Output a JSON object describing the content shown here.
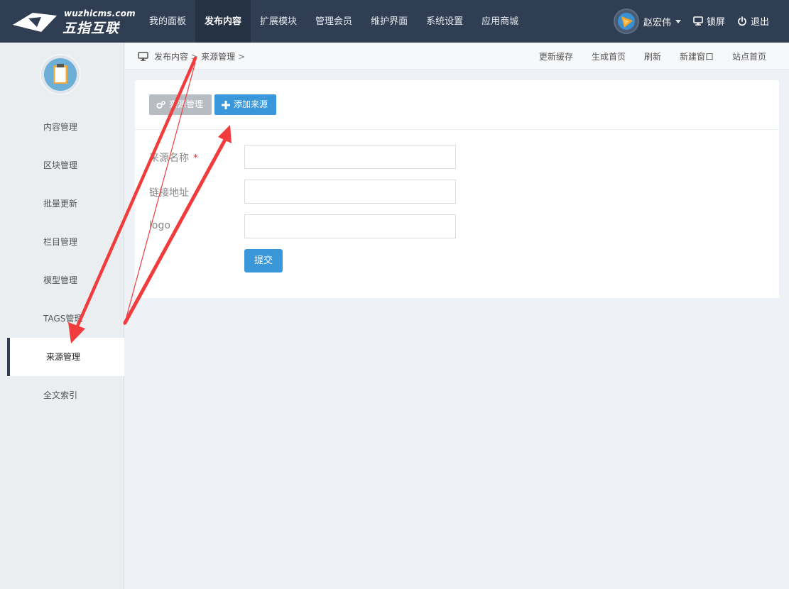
{
  "logo": {
    "en": "wuzhicms.com",
    "cn": "五指互联"
  },
  "topnav": [
    {
      "label": "我的面板",
      "active": false
    },
    {
      "label": "发布内容",
      "active": true
    },
    {
      "label": "扩展模块",
      "active": false
    },
    {
      "label": "管理会员",
      "active": false
    },
    {
      "label": "维护界面",
      "active": false
    },
    {
      "label": "系统设置",
      "active": false
    },
    {
      "label": "应用商城",
      "active": false
    }
  ],
  "user": {
    "name": "赵宏伟",
    "lock_label": "锁屏",
    "logout_label": "退出"
  },
  "sidebar": {
    "items": [
      {
        "label": "内容管理"
      },
      {
        "label": "区块管理"
      },
      {
        "label": "批量更新"
      },
      {
        "label": "栏目管理"
      },
      {
        "label": "模型管理"
      },
      {
        "label": "TAGS管理"
      },
      {
        "label": "来源管理"
      },
      {
        "label": "全文索引"
      }
    ],
    "active_index": 6
  },
  "breadcrumb": {
    "items": [
      "发布内容",
      "来源管理"
    ],
    "separator": ">"
  },
  "crumb_actions": [
    "更新缓存",
    "生成首页",
    "刷新",
    "新建窗口",
    "站点首页"
  ],
  "panel": {
    "manage_button": "来源管理",
    "add_button": "添加来源",
    "fields": [
      {
        "label": "来源名称",
        "required": "*",
        "value": ""
      },
      {
        "label": "链接地址",
        "required": "",
        "value": ""
      },
      {
        "label": "logo",
        "required": "",
        "value": ""
      }
    ],
    "submit_label": "提交"
  },
  "colors": {
    "topbar": "#2f3e52",
    "accent": "#3a97d9",
    "annotation": "#f03c3c"
  }
}
